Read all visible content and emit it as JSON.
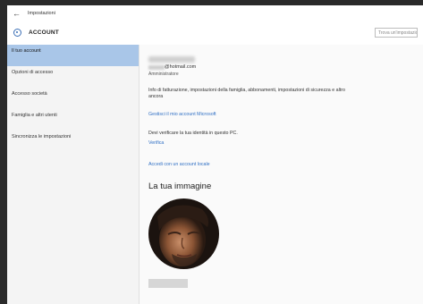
{
  "window": {
    "title": "Impostazioni"
  },
  "header": {
    "section_title": "ACCOUNT",
    "search_placeholder": "Trova un'impostazione"
  },
  "sidebar": {
    "items": [
      {
        "label": "Il tuo account",
        "active": true
      },
      {
        "label": "Opzioni di accesso",
        "active": false
      },
      {
        "label": "Accesso società",
        "active": false
      },
      {
        "label": "Famiglia e altri utenti",
        "active": false
      },
      {
        "label": "Sincronizza le impostazioni",
        "active": false
      }
    ]
  },
  "account": {
    "email_domain": "@hotmail.com",
    "role": "Amministratore",
    "info_text": "Info di fatturazione, impostazioni della famiglia, abbonamenti, impostazioni di sicurezza e altro ancora",
    "manage_link": "Gestisci il mio account Microsoft",
    "verify_text": "Devi verificare la tua identità in questo PC.",
    "verify_link": "Verifica",
    "local_account_link": "Accedi con un account locale"
  },
  "picture": {
    "title": "La tua immagine"
  },
  "colors": {
    "accent": "#2f6fc4",
    "selected": "#a9c6e8"
  }
}
